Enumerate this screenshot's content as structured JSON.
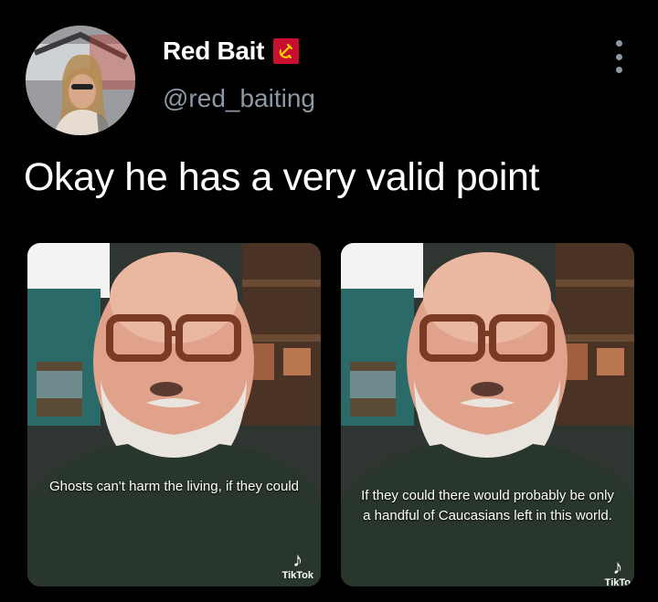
{
  "tweet": {
    "author": {
      "display_name": "Red Bait",
      "badge_icon": "hammer-and-sickle-icon",
      "handle": "@red_baiting"
    },
    "text": "Okay he has a very valid point",
    "media": [
      {
        "caption": "Ghosts can't harm the living, if they could",
        "watermark": "TikTok"
      },
      {
        "caption": "If they could there would probably be only a handful of Caucasians left in this world.",
        "watermark": "TikTo"
      }
    ]
  },
  "colors": {
    "background": "#000000",
    "text_primary": "#ffffff",
    "text_secondary": "#8b98a5",
    "badge_red": "#c8102e",
    "badge_yellow": "#ffd700"
  }
}
